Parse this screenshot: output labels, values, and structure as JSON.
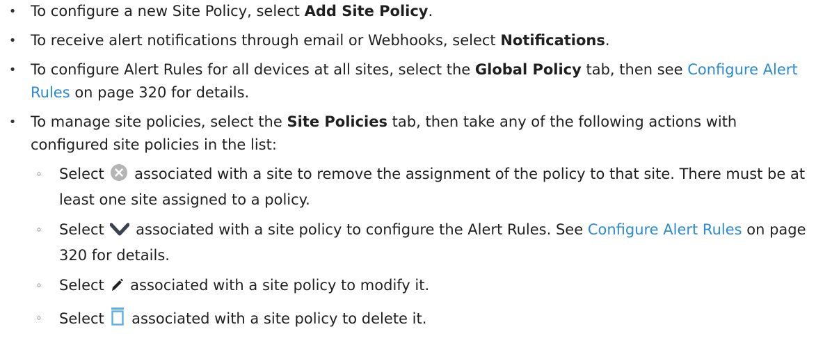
{
  "items": [
    {
      "pre": "To configure a new Site Policy, select ",
      "bold": "Add Site Policy",
      "post": "."
    },
    {
      "pre": "To receive alert notifications through email or Webhooks, select ",
      "bold": "Notifications",
      "post": "."
    },
    {
      "pre": "To configure Alert Rules for all devices at all sites, select the ",
      "bold": "Global Policy",
      "mid": " tab, then see ",
      "link": "Configure Alert Rules",
      "post": " on page 320 for details."
    },
    {
      "pre": "To manage site policies, select the ",
      "bold": "Site Policies",
      "post": " tab, then take any of the following actions with configured site policies in the list:",
      "subitems": [
        {
          "pre": "Select",
          "icon": "remove-circle-icon",
          "post": "associated with a site to remove the assignment of the policy to that site. There must be at least one site assigned to a policy."
        },
        {
          "pre": "Select",
          "icon": "chevron-down-icon",
          "mid": "associated with a site policy to configure the Alert Rules. See ",
          "link": "Configure Alert Rules",
          "post": " on page 320 for details."
        },
        {
          "pre": "Select",
          "icon": "pencil-icon",
          "post": "associated with a site policy to modify it."
        },
        {
          "pre": "Select",
          "icon": "trash-icon",
          "post": "associated with a site policy to delete it."
        }
      ]
    }
  ],
  "colors": {
    "text": "#1f1f1f",
    "link": "#2a8ad4",
    "icon_remove": "#b5b5b5",
    "icon_chevron": "#3c4250",
    "icon_trash": "#5aaee6"
  }
}
